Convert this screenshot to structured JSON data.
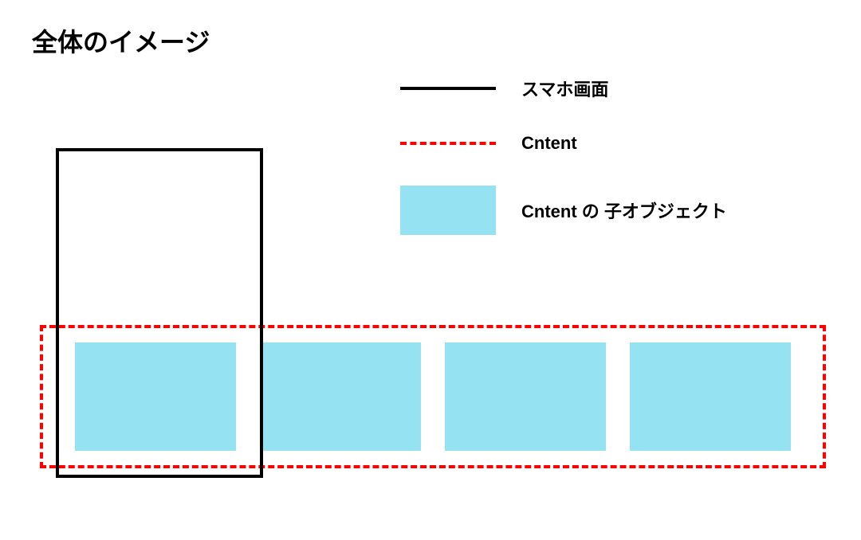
{
  "title": "全体のイメージ",
  "legend": {
    "items": [
      {
        "label": "スマホ画面"
      },
      {
        "label": "Cntent"
      },
      {
        "label": "Cntent の 子オブジェクト"
      }
    ]
  },
  "diagram": {
    "child_count": 4
  }
}
